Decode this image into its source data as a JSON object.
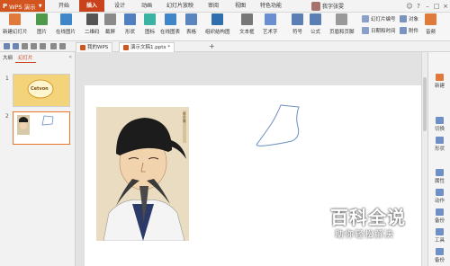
{
  "titlebar": {
    "app_button": "WPS 演示",
    "tabs": [
      "开始",
      "插入",
      "设计",
      "动画",
      "幻灯片放映",
      "审阅",
      "视图",
      "特色功能"
    ],
    "active_tab": "插入",
    "user_name": "我字张雯"
  },
  "ribbon": {
    "tools": [
      "新建幻灯片",
      "图片",
      "在线图片",
      "二维码",
      "截屏",
      "形状",
      "图标",
      "在线图表",
      "表格",
      "组织结构图",
      "文本框",
      "艺术字",
      "符号",
      "公式",
      "页眉和页脚"
    ],
    "small_tools": {
      "slide_number": "幻灯片编号",
      "object": "对象",
      "datetime": "日期和时间",
      "attachment": "附件",
      "audio": "音频"
    }
  },
  "doc_tabs": {
    "my_wps": "我的WPS",
    "current": "演示文稿1.pptx *",
    "add": "+"
  },
  "left_panel": {
    "tabs": [
      "大纲",
      "幻灯片"
    ],
    "slide_numbers": [
      "1",
      "2"
    ],
    "thumb1_logo_text": "Cetvon"
  },
  "right_sidebar": {
    "items": [
      "新建",
      "切换",
      "形状",
      "属性",
      "动作",
      "备份",
      "工具",
      "备份"
    ]
  },
  "slide": {
    "portrait_caption": "李白像"
  },
  "watermark": {
    "title": "百科全说",
    "subtitle": "助你轻松解决"
  },
  "colors": {
    "accent": "#c8431b",
    "app_button": "#d2541f",
    "shape_stroke": "#6b8fbf"
  }
}
